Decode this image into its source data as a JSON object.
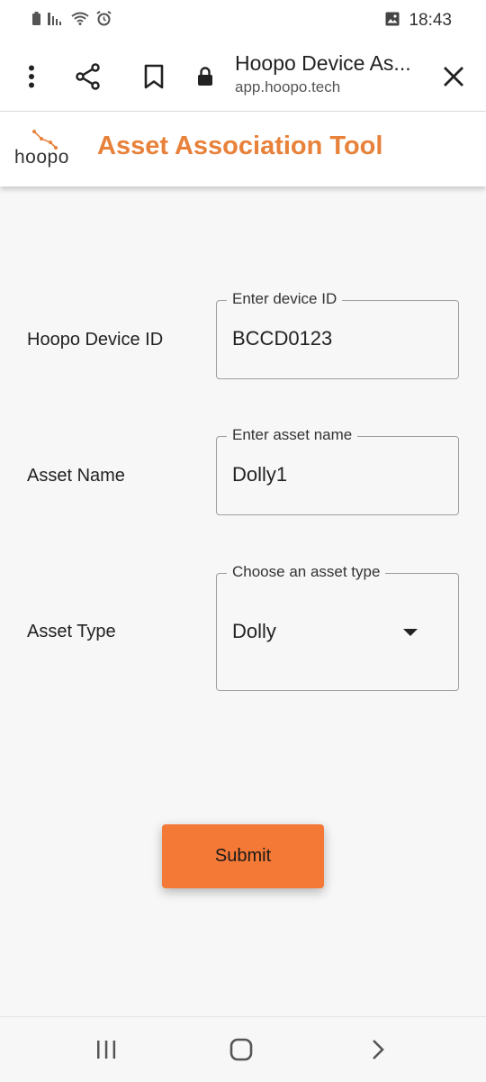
{
  "status_bar": {
    "time": "18:43"
  },
  "browser": {
    "page_title": "Hoopo Device As...",
    "url": "app.hoopo.tech"
  },
  "header": {
    "logo_text": "hoopo",
    "title": "Asset Association Tool",
    "accent_color": "#e8813a"
  },
  "form": {
    "device_id": {
      "label": "Hoopo Device ID",
      "legend": "Enter device ID",
      "value": "BCCD0123"
    },
    "asset_name": {
      "label": "Asset Name",
      "legend": "Enter asset name",
      "value": "Dolly1"
    },
    "asset_type": {
      "label": "Asset Type",
      "legend": "Choose an asset type",
      "selected": "Dolly"
    },
    "submit_label": "Submit",
    "submit_color": "#f47836"
  },
  "icons": {
    "status": [
      "battery-icon",
      "signal-icon",
      "wifi-icon",
      "alarm-icon",
      "image-icon"
    ],
    "toolbar": [
      "menu-dots-icon",
      "share-icon",
      "bookmark-icon",
      "lock-icon",
      "close-icon"
    ],
    "nav": [
      "recents-icon",
      "home-icon",
      "back-icon"
    ]
  }
}
